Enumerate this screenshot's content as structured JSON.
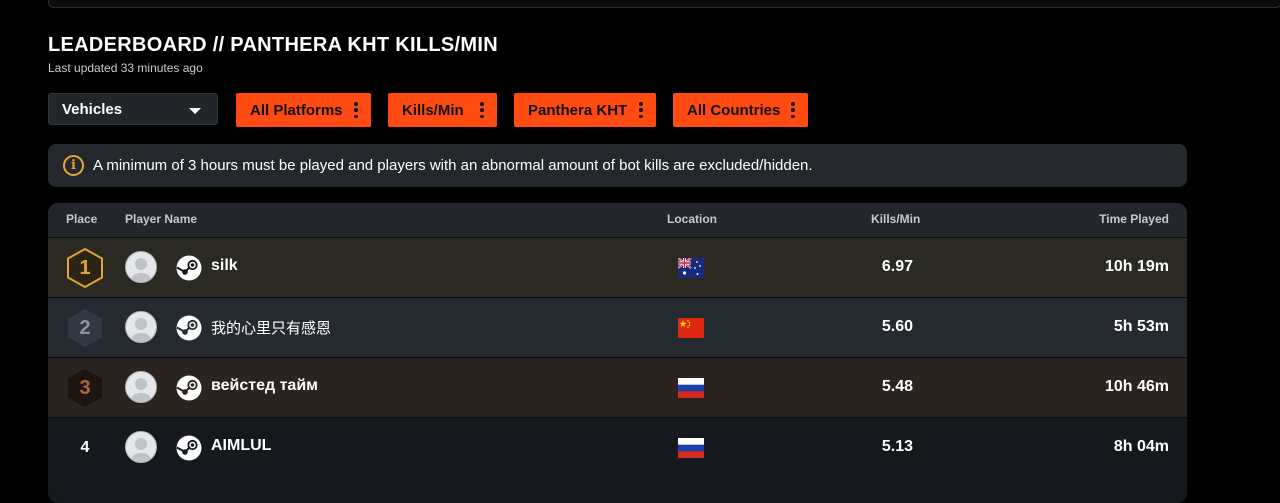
{
  "header": {
    "title": "LEADERBOARD // PANTHERA KHT KILLS/MIN",
    "subtitle": "Last updated 33 minutes ago"
  },
  "filters": {
    "category": "Vehicles",
    "platform": "All Platforms",
    "stat": "Kills/Min",
    "vehicle": "Panthera KHT",
    "country": "All Countries"
  },
  "notice": {
    "icon": "info-icon",
    "text": "A minimum of 3 hours must be played and players with an abnormal amount of bot kills are excluded/hidden."
  },
  "table": {
    "columns": {
      "place": "Place",
      "player": "Player Name",
      "location": "Location",
      "kpm": "Kills/Min",
      "time": "Time Played"
    },
    "rows": [
      {
        "place": "1",
        "name": "silk",
        "country": "Australia",
        "flag": "australia-flag",
        "kpm": "6.97",
        "time": "10h 19m"
      },
      {
        "place": "2",
        "name": "我的心里只有感恩",
        "country": "China",
        "flag": "china-flag",
        "kpm": "5.60",
        "time": "5h 53m"
      },
      {
        "place": "3",
        "name": "вейстед тайм",
        "country": "Russia",
        "flag": "russia-flag",
        "kpm": "5.48",
        "time": "10h 46m"
      },
      {
        "place": "4",
        "name": "AIMLUL",
        "country": "Russia",
        "flag": "russia-flag",
        "kpm": "5.13",
        "time": "8h 04m"
      }
    ]
  },
  "colors": {
    "accent": "#ff4a12",
    "gold": "#e3a53b",
    "silver": "#8b96a3",
    "bronze": "#b0643e",
    "row_gold_bg": "#2a2a22",
    "row_silver_bg": "#252a31",
    "row_bronze_bg": "#2a231f",
    "row_default_bg": "#15181c"
  }
}
